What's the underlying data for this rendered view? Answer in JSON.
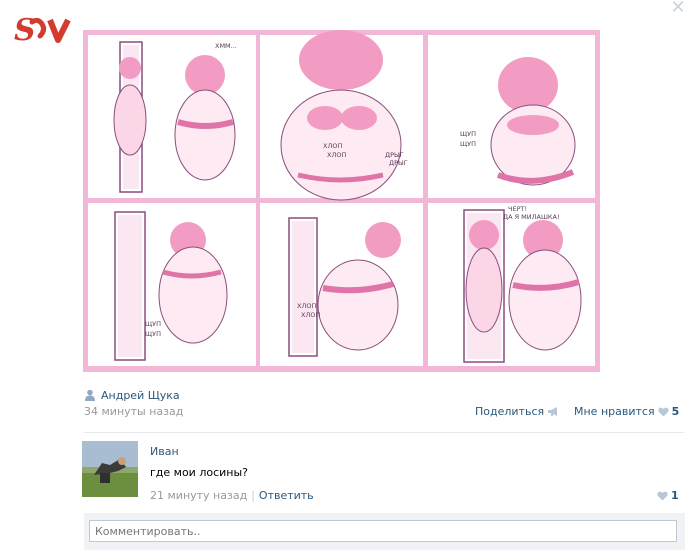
{
  "logo": {
    "text": "S"
  },
  "comic": {
    "panels": [
      {
        "id": 1,
        "sfx": [
          "ХММ..."
        ]
      },
      {
        "id": 2,
        "sfx": [
          "ХЛОП",
          "ХЛОП",
          "ДРЫГ",
          "ДРЫГ"
        ]
      },
      {
        "id": 3,
        "sfx": [
          "ЩУП",
          "ЩУП"
        ]
      },
      {
        "id": 4,
        "sfx": [
          "ЩУП",
          "ЩУП"
        ]
      },
      {
        "id": 5,
        "sfx": [
          "ХЛОП",
          "ХЛОП"
        ]
      },
      {
        "id": 6,
        "sfx": [
          "ЧЕРТ!",
          "ДА Я МИЛАШКА!"
        ]
      }
    ],
    "colors": {
      "background": "#f1b7d6",
      "panel": "#ffffff",
      "character": "#f29cc4",
      "line": "#6b3b63"
    }
  },
  "post": {
    "author": "Андрей Щука",
    "time": "34 минуты назад",
    "share_label": "Поделиться",
    "like_label": "Мне нравится",
    "like_count": "5"
  },
  "comment": {
    "author": "Иван",
    "text": "где мои лосины?",
    "time": "21 минуту назад",
    "separator": "|",
    "reply_label": "Ответить",
    "like_count": "1"
  },
  "comment_input": {
    "placeholder": "Комментировать.."
  },
  "colors": {
    "link": "#2b587a",
    "muted": "#999999",
    "logo": "#d43b2f"
  }
}
